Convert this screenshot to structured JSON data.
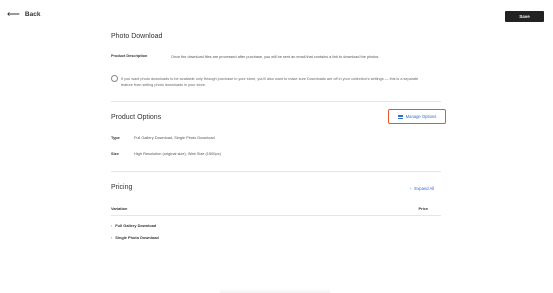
{
  "header": {
    "back_arrow": "⟵",
    "back_label": "Back",
    "save_label": "Save"
  },
  "photo_download": {
    "title": "Photo Download",
    "description_label": "Product Description",
    "description_text": "Once the download files are processed after purchase, you will be sent an email that contains a link to download the photos.",
    "info_text": "If you want photo downloads to be available only through purchase in your store, you'll also want to make sure Downloads are off in your collection's settings — this is a separate feature from selling photo downloads in your store."
  },
  "product_options": {
    "title": "Product Options",
    "manage_label": "Manage Options",
    "type_label": "Type",
    "type_value": "Full Gallery Download, Single Photo Download",
    "size_label": "Size",
    "size_value": "High Resolution (original size), Web Size (1500px)"
  },
  "pricing": {
    "title": "Pricing",
    "expand_label": "Expand All",
    "variation_header": "Variation",
    "price_header": "Price",
    "rows": [
      "Full Gallery Download",
      "Single Photo Download"
    ]
  },
  "icons": {
    "back": "back-arrow-icon",
    "info": "info-icon",
    "manage": "list-icon",
    "expand": "chevron-right-icon"
  },
  "colors": {
    "accent": "#2f6fd1",
    "highlight_border": "#e8582e",
    "save_button": "#222222"
  }
}
